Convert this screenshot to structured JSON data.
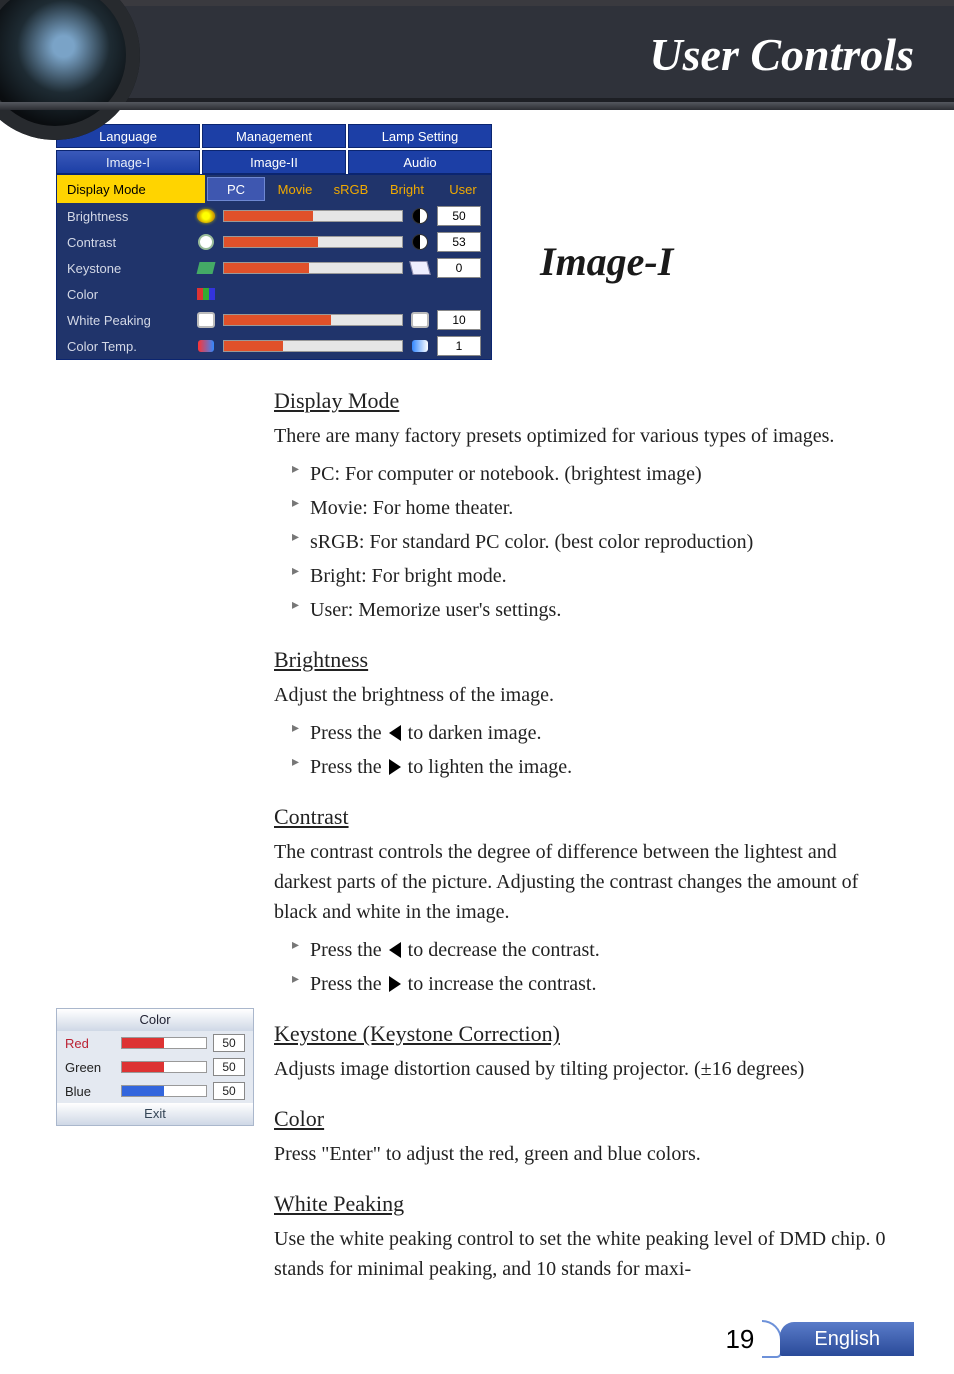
{
  "header_title": "User Controls",
  "section_title": "Image-I",
  "osd": {
    "tabs_top": [
      "Language",
      "Management",
      "Lamp Setting"
    ],
    "tabs_bottom": [
      "Image-I",
      "Image-II",
      "Audio"
    ],
    "active_tab": "Image-I",
    "display_mode_label": "Display Mode",
    "modes": [
      "PC",
      "Movie",
      "sRGB",
      "Bright",
      "User"
    ],
    "selected_mode": "PC",
    "rows": {
      "brightness": {
        "label": "Brightness",
        "value": "50",
        "pct": 50
      },
      "contrast": {
        "label": "Contrast",
        "value": "53",
        "pct": 53
      },
      "keystone": {
        "label": "Keystone",
        "value": "0",
        "pct": 48
      },
      "color": {
        "label": "Color"
      },
      "white": {
        "label": "White Peaking",
        "value": "10",
        "pct": 60
      },
      "temp": {
        "label": "Color Temp.",
        "value": "1",
        "pct": 33
      }
    }
  },
  "sidebox": {
    "title": "Color",
    "rows": {
      "red": {
        "label": "Red",
        "value": "50"
      },
      "green": {
        "label": "Green",
        "value": "50"
      },
      "blue": {
        "label": "Blue",
        "value": "50"
      }
    },
    "exit": "Exit"
  },
  "content": {
    "displaymode": {
      "h": "Display Mode",
      "intro": "There are many factory presets optimized for various types of images.",
      "items": {
        "pc": "PC: For computer or notebook. (brightest image)",
        "movie": "Movie: For home theater.",
        "srgb": "sRGB: For standard PC color. (best color reproduction)",
        "bright": "Bright: For bright mode.",
        "user": "User: Memorize user's settings."
      }
    },
    "brightness": {
      "h": "Brightness",
      "intro": "Adjust the brightness of the image.",
      "left_a": "Press the ",
      "left_b": " to darken image.",
      "right_a": "Press the ",
      "right_b": " to lighten the image."
    },
    "contrast": {
      "h": "Contrast",
      "intro": "The contrast controls the degree of difference between the lightest and darkest parts of the picture. Adjusting the contrast changes the amount of black and white in the image.",
      "left_a": "Press the ",
      "left_b": " to decrease the contrast.",
      "right_a": "Press the ",
      "right_b": " to increase the contrast."
    },
    "keystone": {
      "h": "Keystone (Keystone Correction)",
      "intro": "Adjusts image distortion caused by tilting projector. (±16 degrees)"
    },
    "color": {
      "h": "Color",
      "intro": "Press \"Enter\" to adjust the red, green and blue colors."
    },
    "white": {
      "h": "White Peaking",
      "intro": "Use the white peaking control to set the white peaking level of DMD chip. 0 stands for minimal peaking, and 10 stands for maxi-"
    }
  },
  "footer": {
    "page": "19",
    "lang": "English"
  }
}
